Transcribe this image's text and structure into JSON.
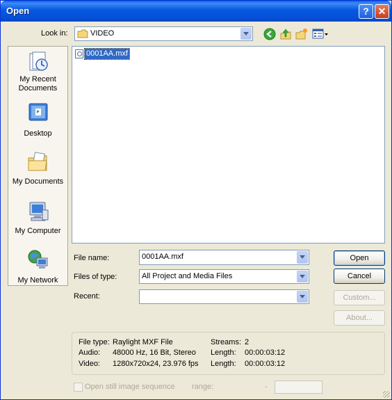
{
  "window": {
    "title": "Open"
  },
  "toolbar": {
    "look_in_label": "Look in:",
    "look_in_value": "VIDEO",
    "icons": [
      "back-icon",
      "up-folder-icon",
      "new-folder-icon",
      "views-menu-icon"
    ]
  },
  "places": [
    {
      "label": "My Recent Documents",
      "icon": "recent-documents-icon"
    },
    {
      "label": "Desktop",
      "icon": "desktop-icon"
    },
    {
      "label": "My Documents",
      "icon": "my-documents-icon"
    },
    {
      "label": "My Computer",
      "icon": "my-computer-icon"
    },
    {
      "label": "My Network",
      "icon": "my-network-icon"
    }
  ],
  "files": [
    {
      "name": "0001AA.mxf",
      "selected": true
    }
  ],
  "fields": {
    "file_name_label": "File name:",
    "file_name_value": "0001AA.mxf",
    "files_of_type_label": "Files of type:",
    "files_of_type_value": "All Project and Media Files",
    "recent_label": "Recent:",
    "recent_value": ""
  },
  "buttons": {
    "open": "Open",
    "cancel": "Cancel",
    "custom": "Custom...",
    "about": "About..."
  },
  "info": {
    "file_type_label": "File type:",
    "file_type_value": "Raylight MXF File",
    "audio_label": "Audio:",
    "audio_value": "48000 Hz, 16 Bit, Stereo",
    "video_label": "Video:",
    "video_value": "1280x720x24, 23.976 fps",
    "streams_label": "Streams:",
    "streams_value": "2",
    "length1_label": "Length:",
    "length1_value": "00:00:03:12",
    "length2_label": "Length:",
    "length2_value": "00:00:03:12"
  },
  "footer": {
    "still_image_label": "Open still image sequence",
    "range_label": "range:",
    "range_dash": "-"
  },
  "colors": {
    "titlebar": "#0758e0",
    "selection": "#316ac5",
    "dialog_bg": "#ece9d8",
    "disabled_text": "#aca899"
  }
}
